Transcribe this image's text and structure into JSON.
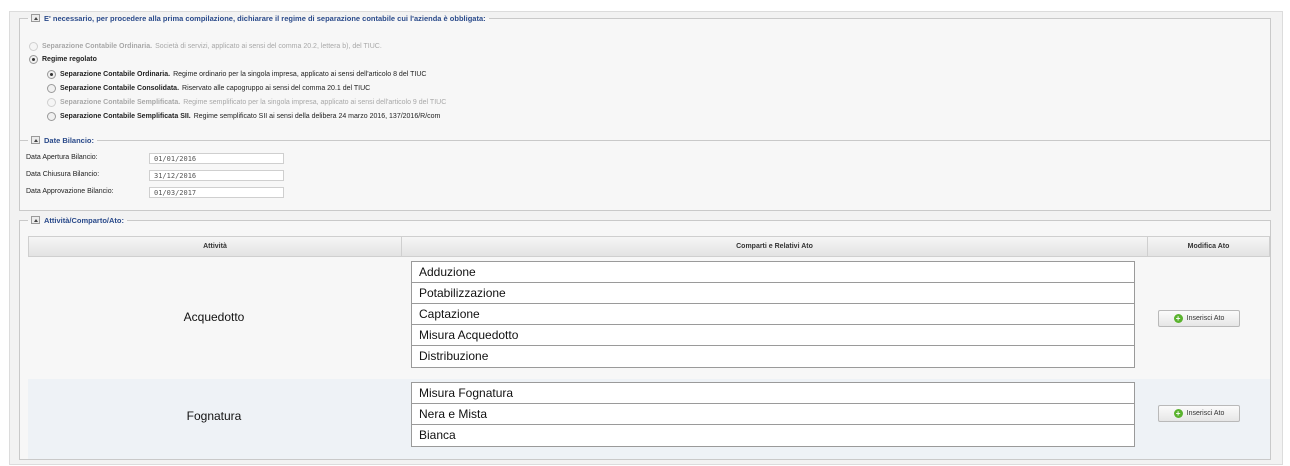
{
  "section_regime": {
    "legend": "E' necessario, per procedere alla prima compilazione, dichiarare il regime di separazione contabile cui l'azienda è obbligata:",
    "opt_ordinaria_servizi": {
      "title": "Separazione Contabile Ordinaria.",
      "desc": "Società di servizi, applicato ai sensi del comma 20.2, lettera b), del TIUC."
    },
    "opt_regolato": {
      "title": "Regime regolato"
    },
    "sub_options": [
      {
        "title": "Separazione Contabile Ordinaria.",
        "desc": "Regime ordinario per la singola impresa, applicato ai sensi dell'articolo 8 del TIUC"
      },
      {
        "title": "Separazione Contabile Consolidata.",
        "desc": "Riservato alle capogruppo ai sensi del comma 20.1 del TIUC"
      },
      {
        "title": "Separazione Contabile Semplificata.",
        "desc": "Regime semplificato per la singola impresa, applicato ai sensi dell'articolo 9 del TIUC"
      },
      {
        "title": "Separazione Contabile Semplificata SII.",
        "desc": "Regime semplificato SII ai sensi della delibera 24 marzo 2016, 137/2016/R/com"
      }
    ]
  },
  "section_date": {
    "legend": "Date Bilancio:",
    "fields": [
      {
        "label": "Data Apertura Bilancio:",
        "value": "01/01/2016"
      },
      {
        "label": "Data Chiusura Bilancio:",
        "value": "31/12/2016"
      },
      {
        "label": "Data Approvazione Bilancio:",
        "value": "01/03/2017"
      }
    ]
  },
  "section_attivita": {
    "legend": "Attività/Comparto/Ato:",
    "headers": {
      "attivita": "Attività",
      "comparti": "Comparti e Relativi Ato",
      "modifica": "Modifica Ato"
    },
    "rows": [
      {
        "attivita": "Acquedotto",
        "comparti": [
          "Adduzione",
          "Potabilizzazione",
          "Captazione",
          "Misura Acquedotto",
          "Distribuzione"
        ],
        "button": "Inserisci Ato"
      },
      {
        "attivita": "Fognatura",
        "comparti": [
          "Misura Fognatura",
          "Nera e Mista",
          "Bianca"
        ],
        "button": "Inserisci Ato"
      }
    ]
  },
  "colors": {
    "legend": "#2a4a8a",
    "alt_row": "#eef2f6",
    "plus_icon": "#5ab32e"
  }
}
